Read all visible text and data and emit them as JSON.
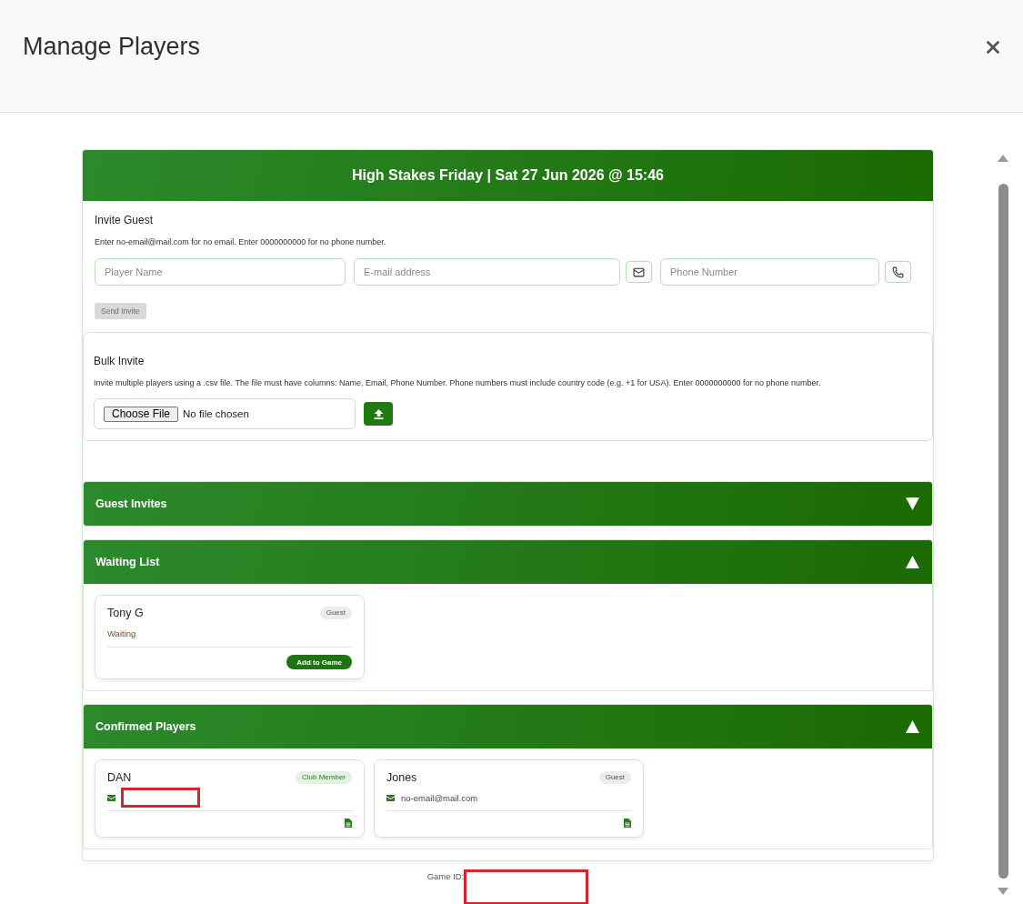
{
  "dialog": {
    "title": "Manage Players"
  },
  "event": {
    "title": "High Stakes Friday | Sat 27 Jun 2026 @ 15:46"
  },
  "invite_guest": {
    "title": "Invite Guest",
    "hint": "Enter no-email@mail.com for no email. Enter 0000000000 for no phone number.",
    "fields": [
      {
        "kind": "text",
        "placeholder": "Player Name"
      },
      {
        "kind": "email",
        "placeholder": "E-mail address"
      },
      {
        "kind": "phone",
        "placeholder": "Phone Number"
      }
    ],
    "send_button": {
      "label": "Send Invite",
      "disabled": true
    }
  },
  "bulk_invite": {
    "title": "Bulk Invite",
    "hint": "Invite multiple players using a .csv file. The file must have columns: Name, Email, Phone Number. Phone numbers must include country code (e.g. +1 for USA). Enter 0000000000 for no phone number.",
    "file_button": "Choose File",
    "file_status": "No file chosen"
  },
  "sections": [
    {
      "title": "Guest Invites",
      "expanded": false
    },
    {
      "title": "Waiting List",
      "expanded": true,
      "players": [
        {
          "kind": "waiting",
          "name": "Tony G",
          "badge": {
            "label": "Guest",
            "kind": "guest"
          },
          "status": "Waiting",
          "action": "Add to Game"
        }
      ]
    },
    {
      "title": "Confirmed Players",
      "expanded": true,
      "players": [
        {
          "kind": "confirmed",
          "name": "DAN",
          "badge": {
            "label": "Club Member",
            "kind": "member"
          },
          "email_redacted": true
        },
        {
          "kind": "confirmed",
          "name": "Jones",
          "badge": {
            "label": "Guest",
            "kind": "guest"
          },
          "email": "no-email@mail.com"
        }
      ]
    }
  ],
  "game_id": {
    "label": "Game ID:",
    "redacted": true
  }
}
